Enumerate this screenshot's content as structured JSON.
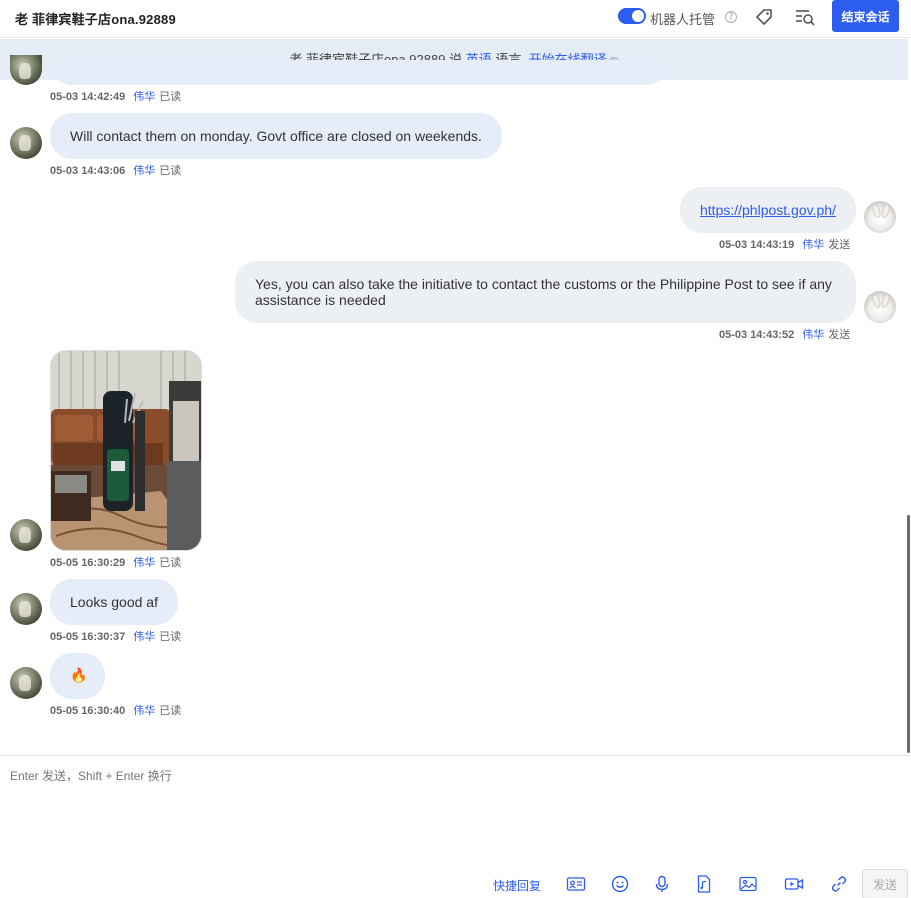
{
  "header": {
    "title": "老 菲律宾鞋子店ona.92889",
    "robot_label": "机器人托管",
    "robot_enabled": true,
    "end_button_label": "结束会话",
    "icons": [
      "tag-icon",
      "search-list-icon",
      "help-icon"
    ]
  },
  "banner": {
    "prefix": "老 菲律宾鞋子店ona.92889 说",
    "language_link": "英语",
    "middle": "语言,",
    "translate_link": "开始在线翻译"
  },
  "messages": [
    {
      "direction": "in",
      "type": "text",
      "text": "",
      "time": "05-03 14:42:49",
      "agent": "伟华",
      "status": "已读"
    },
    {
      "direction": "in",
      "type": "text",
      "text": "Will contact them on monday. Govt office are closed on weekends.",
      "time": "05-03 14:43:06",
      "agent": "伟华",
      "status": "已读"
    },
    {
      "direction": "out",
      "type": "link",
      "text": "https://phlpost.gov.ph/",
      "time": "05-03 14:43:19",
      "agent": "伟华",
      "status": "发送"
    },
    {
      "direction": "out",
      "type": "text",
      "text": "Yes, you can also take the initiative to contact the customs or the Philippine Post to see if any assistance is needed",
      "time": "05-03 14:43:52",
      "agent": "伟华",
      "status": "发送"
    },
    {
      "direction": "in",
      "type": "image",
      "image": "photo-golf-bag-in-living-room",
      "time": "05-05 16:30:29",
      "agent": "伟华",
      "status": "已读"
    },
    {
      "direction": "in",
      "type": "text",
      "text": "Looks good af",
      "time": "05-05 16:30:37",
      "agent": "伟华",
      "status": "已读"
    },
    {
      "direction": "in",
      "type": "emoji",
      "text": "🔥",
      "time": "05-05 16:30:40",
      "agent": "伟华",
      "status": "已读"
    }
  ],
  "composer": {
    "placeholder": "Enter 发送，Shift + Enter 换行",
    "quick_reply_label": "快捷回复",
    "send_label": "发送",
    "tools": [
      "contact-card-icon",
      "emoji-icon",
      "microphone-icon",
      "audio-file-icon",
      "image-icon",
      "video-icon",
      "link-icon"
    ]
  },
  "colors": {
    "accent": "#2c5cf0",
    "banner_bg": "#e6ecf6",
    "incoming_bubble": "#e6ecf8",
    "outgoing_bubble": "#eceff4"
  }
}
